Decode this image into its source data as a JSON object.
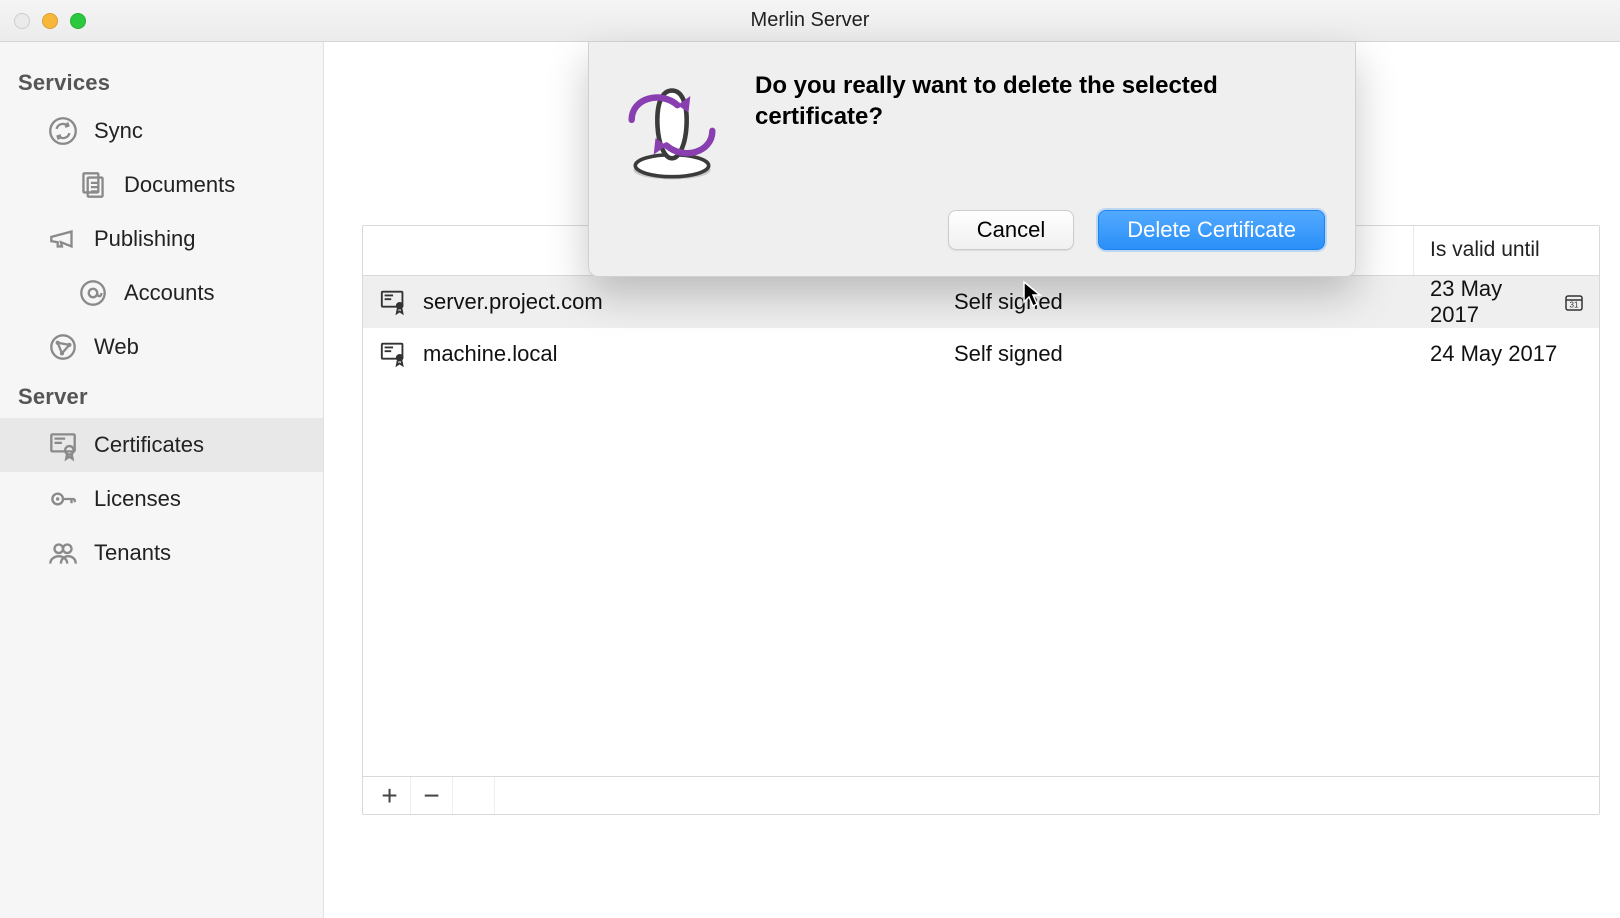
{
  "window": {
    "title": "Merlin Server"
  },
  "sidebar": {
    "sections": [
      {
        "label": "Services",
        "items": [
          {
            "id": "sync",
            "label": "Sync",
            "icon": "sync-icon"
          },
          {
            "id": "documents",
            "label": "Documents",
            "icon": "documents-icon",
            "child": true
          },
          {
            "id": "publishing",
            "label": "Publishing",
            "icon": "megaphone-icon"
          },
          {
            "id": "accounts",
            "label": "Accounts",
            "icon": "at-icon",
            "child": true
          },
          {
            "id": "web",
            "label": "Web",
            "icon": "globe-icon"
          }
        ]
      },
      {
        "label": "Server",
        "items": [
          {
            "id": "certificates",
            "label": "Certificates",
            "icon": "certificate-icon",
            "selected": true
          },
          {
            "id": "licenses",
            "label": "Licenses",
            "icon": "key-icon"
          },
          {
            "id": "tenants",
            "label": "Tenants",
            "icon": "users-icon"
          }
        ]
      }
    ]
  },
  "table": {
    "columns": {
      "name": "",
      "type": "",
      "valid": "Is valid until"
    },
    "rows": [
      {
        "name": "server.project.com",
        "type": "Self signed",
        "valid": "23 May 2017",
        "selected": true,
        "cal": true
      },
      {
        "name": "machine.local",
        "type": "Self signed",
        "valid": "24 May 2017"
      }
    ],
    "footer": {
      "add": "+",
      "remove": "−"
    }
  },
  "dialog": {
    "icon": "merlin-app-icon",
    "message": "Do you really want to delete the selected certificate?",
    "cancel": "Cancel",
    "confirm": "Delete Certificate"
  }
}
